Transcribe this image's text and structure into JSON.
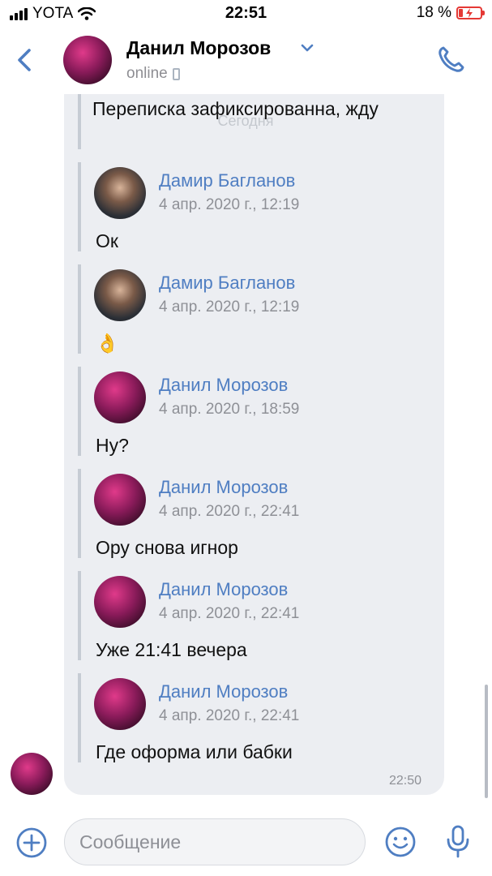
{
  "status_bar": {
    "carrier": "YOTA",
    "time": "22:51",
    "battery_percent": "18 %",
    "battery_level": 0.18
  },
  "header": {
    "contact_name": "Данил Морозов",
    "status": "online"
  },
  "chat": {
    "date_divider": "Сегодня",
    "first_message_text": "Переписка зафиксированна, жду",
    "forwarded": [
      {
        "author": "Дамир Багланов",
        "date": "4 апр. 2020 г., 12:19",
        "text": "Ок",
        "avatar": "dark"
      },
      {
        "author": "Дамир Багланов",
        "date": "4 апр. 2020 г., 12:19",
        "text": "👌",
        "avatar": "dark"
      },
      {
        "author": "Данил Морозов",
        "date": "4 апр. 2020 г., 18:59",
        "text": "Ну?",
        "avatar": "pink"
      },
      {
        "author": "Данил Морозов",
        "date": "4 апр. 2020 г., 22:41",
        "text": "Ору снова игнор",
        "avatar": "pink"
      },
      {
        "author": "Данил Морозов",
        "date": "4 апр. 2020 г., 22:41",
        "text": "Уже 21:41 вечера",
        "avatar": "pink"
      },
      {
        "author": "Данил Морозов",
        "date": "4 апр. 2020 г., 22:41",
        "text": "Где оформа или бабки",
        "avatar": "pink"
      }
    ],
    "message_time": "22:50"
  },
  "input": {
    "placeholder": "Сообщение"
  },
  "colors": {
    "accent": "#4f7ec2",
    "bubble": "#eceef2",
    "battery_low": "#e53935"
  },
  "icons": [
    "signal-icon",
    "wifi-icon",
    "battery-icon",
    "back-icon",
    "chevron-down-icon",
    "phone-icon",
    "plus-icon",
    "emoji-icon",
    "microphone-icon"
  ]
}
